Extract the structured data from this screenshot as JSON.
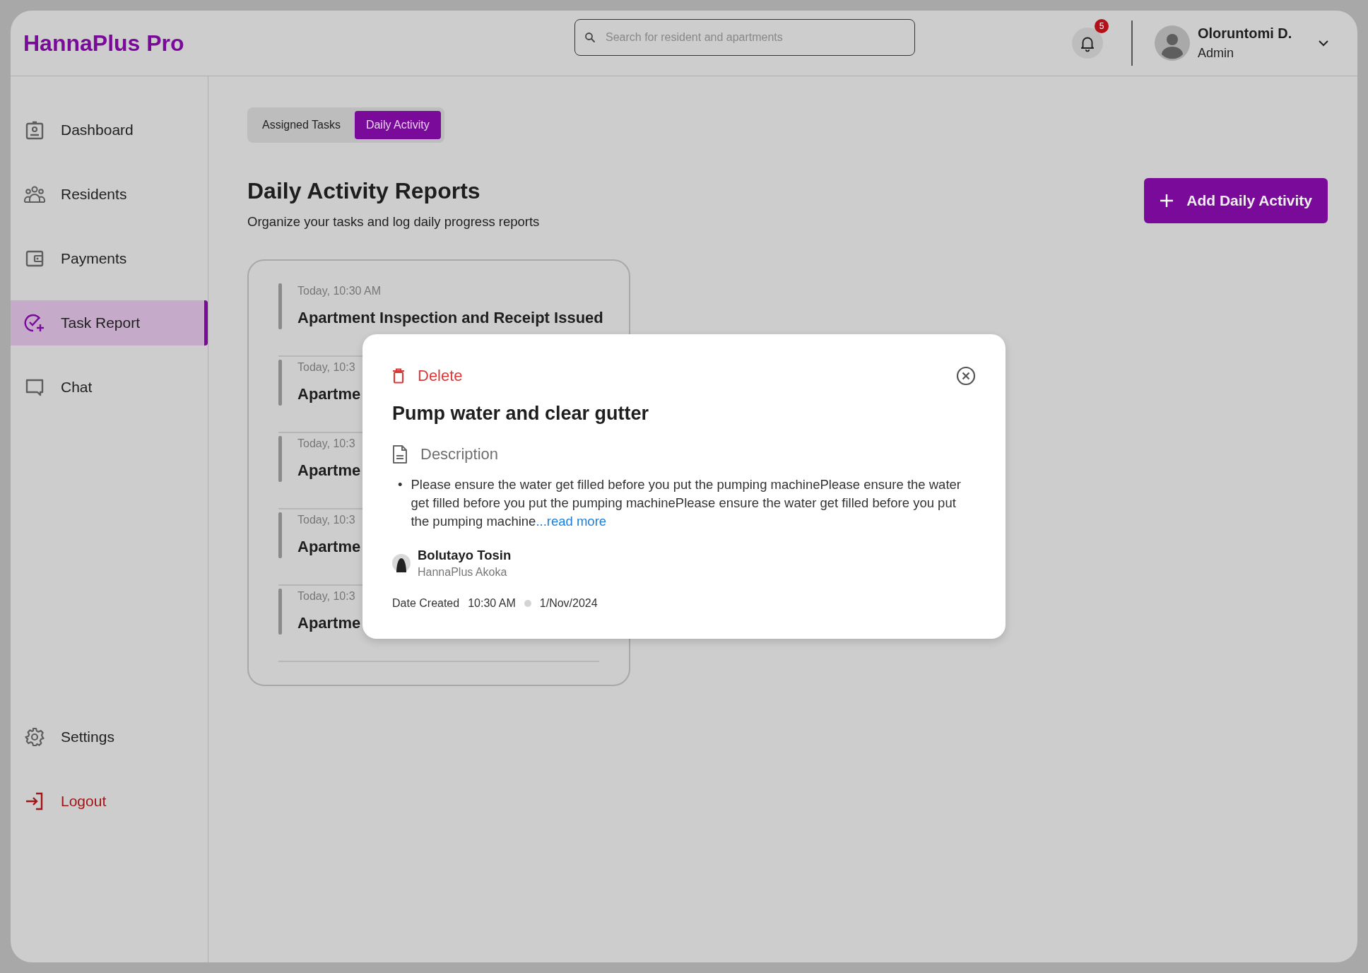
{
  "app": {
    "logo": "HannaPlus Pro"
  },
  "header": {
    "search": {
      "placeholder": "Search for resident and apartments"
    },
    "notifications": {
      "count": "5"
    },
    "user": {
      "name": "Oloruntomi D.",
      "role": "Admin"
    }
  },
  "sidebar": {
    "items": [
      {
        "label": "Dashboard",
        "kind": "dashboard",
        "selected": false
      },
      {
        "label": "Residents",
        "kind": "residents",
        "selected": false
      },
      {
        "label": "Payments",
        "kind": "payments",
        "selected": false
      },
      {
        "label": "Task Report",
        "kind": "tasks",
        "selected": true
      },
      {
        "label": "Chat",
        "kind": "chat",
        "selected": false
      }
    ],
    "bottom_items": [
      {
        "label": "Settings",
        "kind": "settings"
      },
      {
        "label": "Logout",
        "kind": "logout"
      }
    ]
  },
  "tabs": [
    {
      "label": "Assigned Tasks",
      "selected": false
    },
    {
      "label": "Daily Activity",
      "selected": true
    }
  ],
  "page": {
    "title": "Daily Activity Reports",
    "subtitle": "Organize your tasks and log daily progress reports",
    "add_button": "Add Daily Activity"
  },
  "reports": [
    {
      "time": "Today, 10:30 AM",
      "title": "Apartment Inspection and Receipt Issued"
    },
    {
      "time": "Today, 10:3",
      "title": "Apartme"
    },
    {
      "time": "Today, 10:3",
      "title": "Apartme"
    },
    {
      "time": "Today, 10:3",
      "title": "Apartme"
    },
    {
      "time": "Today, 10:3",
      "title": "Apartme"
    }
  ],
  "modal": {
    "delete": "Delete",
    "title": "Pump water and clear gutter",
    "description_label": "Description",
    "bullet": "•",
    "description": "Please ensure the water get filled before you put the pumping machinePlease ensure the water get filled before you put the pumping machinePlease ensure the water get filled before you put the pumping machine",
    "read_more": "...read more",
    "person": {
      "name": "Bolutayo Tosin",
      "org": "HannaPlus Akoka"
    },
    "date_label": "Date Created",
    "time": "10:30 AM",
    "date": "1/Nov/2024"
  }
}
